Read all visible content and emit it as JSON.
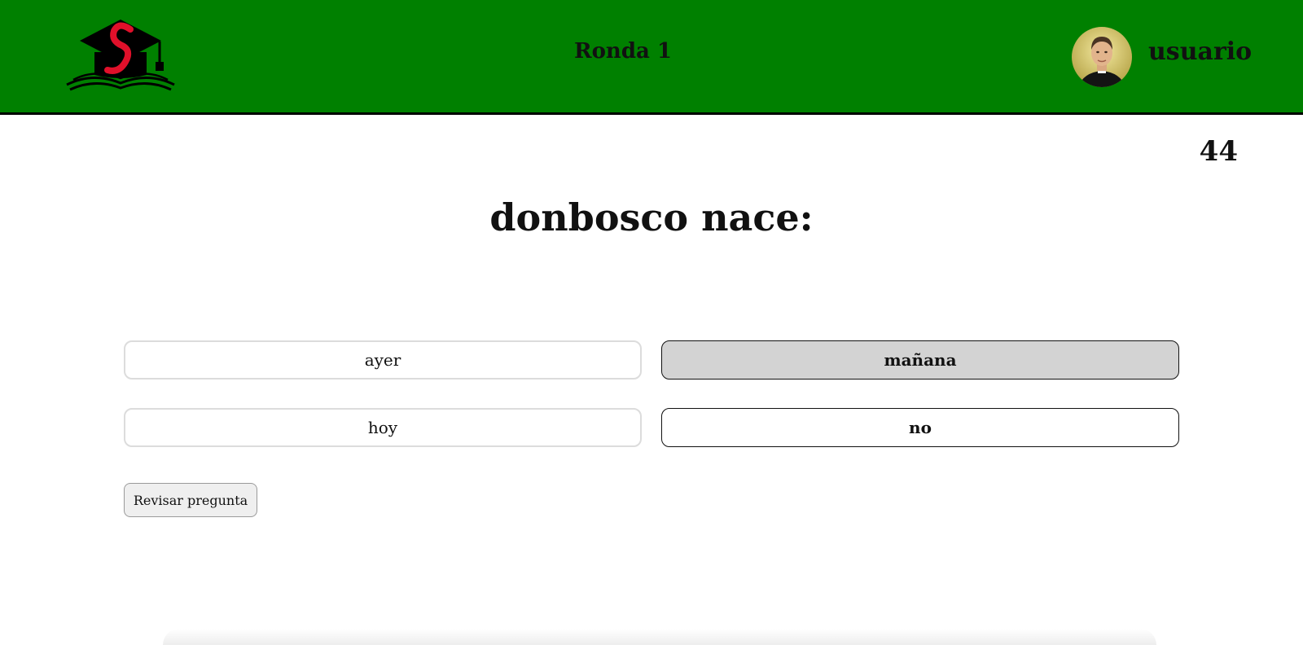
{
  "header": {
    "logo_icon": "graduation-cap-book-logo",
    "round_title": "Ronda 1",
    "username": "usuario",
    "avatar_icon": "user-avatar-photo",
    "background_color": "#008000"
  },
  "quiz": {
    "score": "44",
    "question": "donbosco nace:",
    "answers": [
      {
        "label": "ayer",
        "state": "default"
      },
      {
        "label": "mañana",
        "state": "selected"
      },
      {
        "label": "hoy",
        "state": "default"
      },
      {
        "label": "no",
        "state": "outlined"
      }
    ],
    "review_button": "Revisar pregunta"
  }
}
